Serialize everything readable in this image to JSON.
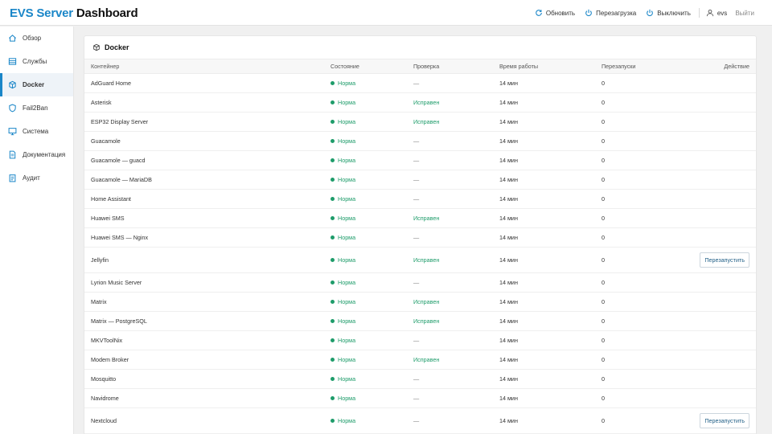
{
  "header": {
    "title_main": "EVS Server",
    "title_sub": "Dashboard",
    "refresh_label": "Обновить",
    "reboot_label": "Перезагрузка",
    "shutdown_label": "Выключить",
    "user": "evs",
    "logout_label": "Выйти"
  },
  "sidebar": {
    "items": [
      {
        "label": "Обзор",
        "icon": "home-icon"
      },
      {
        "label": "Службы",
        "icon": "services-icon"
      },
      {
        "label": "Docker",
        "icon": "docker-box-icon",
        "active": true
      },
      {
        "label": "Fail2Ban",
        "icon": "shield-icon"
      },
      {
        "label": "Система",
        "icon": "monitor-icon"
      },
      {
        "label": "Документация",
        "icon": "document-icon"
      },
      {
        "label": "Аудит",
        "icon": "clipboard-icon"
      }
    ]
  },
  "panel": {
    "title": "Docker",
    "columns": [
      "Контейнер",
      "Состояние",
      "Проверка",
      "Время работы",
      "Перезапуски",
      "Действие"
    ]
  },
  "containers": [
    {
      "name": "AdGuard Home",
      "state": "Норма",
      "check": "—",
      "uptime": "14 мин",
      "restarts": "0",
      "action": ""
    },
    {
      "name": "Asterisk",
      "state": "Норма",
      "check": "Исправен",
      "uptime": "14 мин",
      "restarts": "0",
      "action": ""
    },
    {
      "name": "ESP32 Display Server",
      "state": "Норма",
      "check": "Исправен",
      "uptime": "14 мин",
      "restarts": "0",
      "action": ""
    },
    {
      "name": "Guacamole",
      "state": "Норма",
      "check": "—",
      "uptime": "14 мин",
      "restarts": "0",
      "action": ""
    },
    {
      "name": "Guacamole — guacd",
      "state": "Норма",
      "check": "—",
      "uptime": "14 мин",
      "restarts": "0",
      "action": ""
    },
    {
      "name": "Guacamole — MariaDB",
      "state": "Норма",
      "check": "—",
      "uptime": "14 мин",
      "restarts": "0",
      "action": ""
    },
    {
      "name": "Home Assistant",
      "state": "Норма",
      "check": "—",
      "uptime": "14 мин",
      "restarts": "0",
      "action": ""
    },
    {
      "name": "Huawei SMS",
      "state": "Норма",
      "check": "Исправен",
      "uptime": "14 мин",
      "restarts": "0",
      "action": ""
    },
    {
      "name": "Huawei SMS — Nginx",
      "state": "Норма",
      "check": "—",
      "uptime": "14 мин",
      "restarts": "0",
      "action": ""
    },
    {
      "name": "Jellyfin",
      "state": "Норма",
      "check": "Исправен",
      "uptime": "14 мин",
      "restarts": "0",
      "action": "Перезапустить"
    },
    {
      "name": "Lyrion Music Server",
      "state": "Норма",
      "check": "—",
      "uptime": "14 мин",
      "restarts": "0",
      "action": ""
    },
    {
      "name": "Matrix",
      "state": "Норма",
      "check": "Исправен",
      "uptime": "14 мин",
      "restarts": "0",
      "action": ""
    },
    {
      "name": "Matrix — PostgreSQL",
      "state": "Норма",
      "check": "Исправен",
      "uptime": "14 мин",
      "restarts": "0",
      "action": ""
    },
    {
      "name": "MKVToolNix",
      "state": "Норма",
      "check": "—",
      "uptime": "14 мин",
      "restarts": "0",
      "action": ""
    },
    {
      "name": "Modem Broker",
      "state": "Норма",
      "check": "Исправен",
      "uptime": "14 мин",
      "restarts": "0",
      "action": ""
    },
    {
      "name": "Mosquitto",
      "state": "Норма",
      "check": "—",
      "uptime": "14 мин",
      "restarts": "0",
      "action": ""
    },
    {
      "name": "Navidrome",
      "state": "Норма",
      "check": "—",
      "uptime": "14 мин",
      "restarts": "0",
      "action": ""
    },
    {
      "name": "Nextcloud",
      "state": "Норма",
      "check": "—",
      "uptime": "14 мин",
      "restarts": "0",
      "action": "Перезапустить"
    }
  ],
  "colors": {
    "accent": "#1a86c8",
    "ok": "#1e9c6a"
  }
}
